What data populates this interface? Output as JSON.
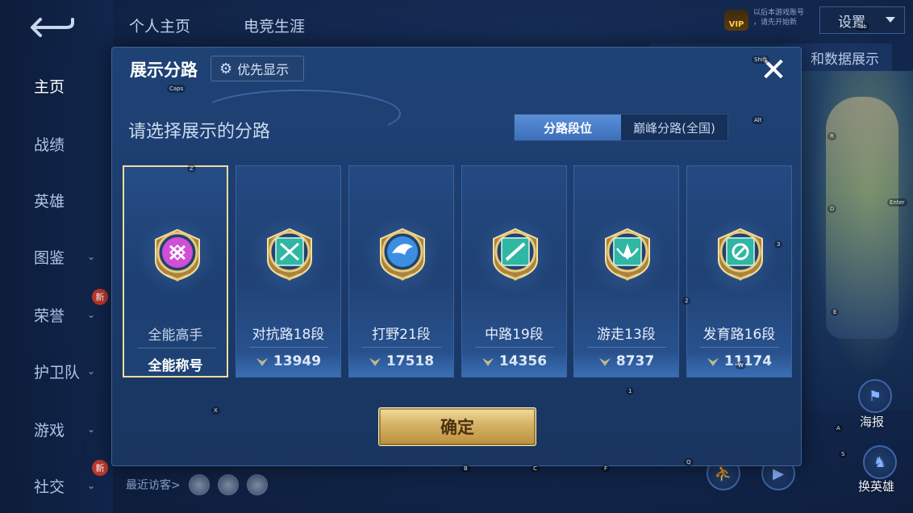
{
  "left_nav": {
    "items": [
      {
        "label": "主页",
        "active": true,
        "chevron": false,
        "new": false
      },
      {
        "label": "战绩",
        "active": false,
        "chevron": false,
        "new": false
      },
      {
        "label": "英雄",
        "active": false,
        "chevron": false,
        "new": false
      },
      {
        "label": "图鉴",
        "active": false,
        "chevron": true,
        "new": false
      },
      {
        "label": "荣誉",
        "active": false,
        "chevron": true,
        "new": true
      },
      {
        "label": "护卫队",
        "active": false,
        "chevron": true,
        "new": false
      },
      {
        "label": "游戏",
        "active": false,
        "chevron": true,
        "new": false
      },
      {
        "label": "社交",
        "active": false,
        "chevron": true,
        "new": true
      }
    ],
    "new_badge": "新"
  },
  "top_tabs": [
    "个人主页",
    "电竞生涯"
  ],
  "top_right": {
    "vip_label": "VIP",
    "note_line1": "以后本游戏账号",
    "note_line2": "，请先开始新",
    "settings_label": "设置",
    "banner_text": "和数据展示"
  },
  "right_side": {
    "haihao_label": "海报",
    "change_hero_label": "换英雄"
  },
  "visitors": {
    "label": "最近访客>"
  },
  "modal": {
    "title": "展示分路",
    "priority_label": "优先显示",
    "close_glyph": "✕",
    "subtitle": "请选择展示的分路",
    "toggle": {
      "left": "分路段位",
      "right": "巅峰分路(全国)",
      "active": "left"
    },
    "cards": [
      {
        "name": "全能高手",
        "value": "全能称号",
        "selected": true,
        "emblem": "allround-emblem-icon",
        "accent": "#d14fd6"
      },
      {
        "name": "对抗路18段",
        "value": "13949",
        "selected": false,
        "emblem": "clash-lane-emblem-icon",
        "accent": "#2fb7a3"
      },
      {
        "name": "打野21段",
        "value": "17518",
        "selected": false,
        "emblem": "jungle-emblem-icon",
        "accent": "#3c8fe0"
      },
      {
        "name": "中路19段",
        "value": "14356",
        "selected": false,
        "emblem": "mid-lane-emblem-icon",
        "accent": "#2fb7a3"
      },
      {
        "name": "游走13段",
        "value": "8737",
        "selected": false,
        "emblem": "roam-emblem-icon",
        "accent": "#2fb7a3"
      },
      {
        "name": "发育路16段",
        "value": "11174",
        "selected": false,
        "emblem": "farm-lane-emblem-icon",
        "accent": "#2fb7a3"
      }
    ],
    "confirm_label": "确定"
  },
  "key_hints": [
    "Caps",
    "Shift",
    "Tab",
    "Alt",
    "Z",
    "R",
    "Enter",
    "D",
    "3",
    "2",
    "E",
    "1",
    "W",
    "X",
    "A",
    "S",
    "B",
    "C",
    "F",
    "Q"
  ],
  "colors": {
    "accent_gold": "#d5b264",
    "selected_border": "#f2dc9a",
    "toggle_on": "#4a7fc9"
  }
}
